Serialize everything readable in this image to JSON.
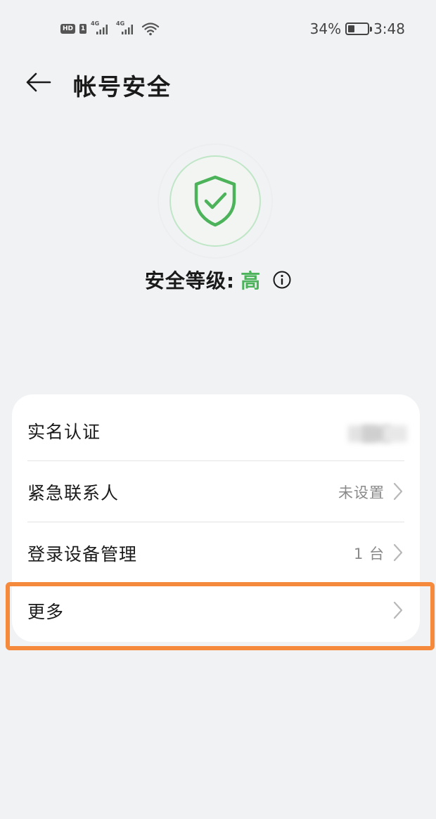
{
  "status_bar": {
    "hd_badge": "HD",
    "sim_badge": "1",
    "network_1": "4G",
    "network_2": "4G",
    "battery_percent": "34%",
    "battery_level": 0.34,
    "time": "3:48",
    "icons": [
      "hd-icon",
      "sim-1-icon",
      "signal-4g-icon",
      "signal-4g-icon",
      "wifi-icon",
      "battery-icon"
    ]
  },
  "header": {
    "back_icon": "arrow-left-icon",
    "title": "帐号安全"
  },
  "security": {
    "icon": "shield-check-icon",
    "level_label": "安全等级:",
    "level_value": "高",
    "info_icon": "info-circle-icon",
    "accent_color": "#4cb35a"
  },
  "menu": {
    "items": [
      {
        "label": "实名认证",
        "value": ""
      },
      {
        "label": "紧急联系人",
        "value": "未设置"
      },
      {
        "label": "登录设备管理",
        "value": "1 台"
      },
      {
        "label": "更多",
        "value": ""
      }
    ],
    "chevron_icon": "chevron-right-icon"
  },
  "colors": {
    "background": "#f1f2f4",
    "card": "#ffffff",
    "highlight": "#f58a3c"
  }
}
